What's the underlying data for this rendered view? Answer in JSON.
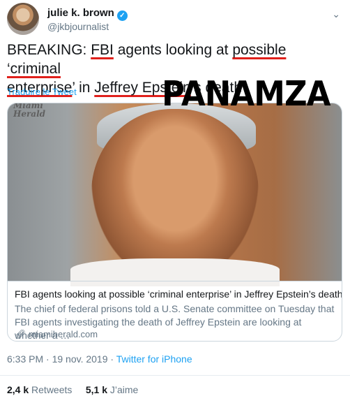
{
  "author": {
    "name": "julie k. brown",
    "handle": "@jkbjournalist"
  },
  "tweet": {
    "parts": [
      "BREAKING: ",
      "FBI",
      " agents looking at ",
      "possible ‘criminal",
      " ",
      "enterprise",
      "’ in ",
      "Jeffrey Epstein",
      "’s death"
    ],
    "translate_label": "Traduire le Tweet"
  },
  "watermark": "PANAMZA",
  "card": {
    "masthead_line1": "Miami",
    "masthead_line2": "Herald",
    "title": "FBI agents looking at possible ‘criminal enterprise’ in Jeffrey Epstein’s death",
    "description": "The chief of federal prisons told a U.S. Senate committee on Tuesday that FBI agents investigating the death of Jeffrey Epstein are looking at whether a …",
    "link": "miamiherald.com"
  },
  "meta": {
    "time": "6:33 PM · 19 nov. 2019 · ",
    "app": "Twitter for iPhone"
  },
  "stats": {
    "retweets_count": "2,4 k",
    "retweets_label": " Retweets",
    "likes_count": "5,1 k",
    "likes_label": " J’aime"
  },
  "icons": {
    "verified": "verified-badge-icon",
    "more": "chevron-down-icon",
    "link": "link-icon"
  },
  "colors": {
    "accent": "#1da1f2",
    "underline": "#e0201b",
    "secondary_text": "#657786"
  }
}
